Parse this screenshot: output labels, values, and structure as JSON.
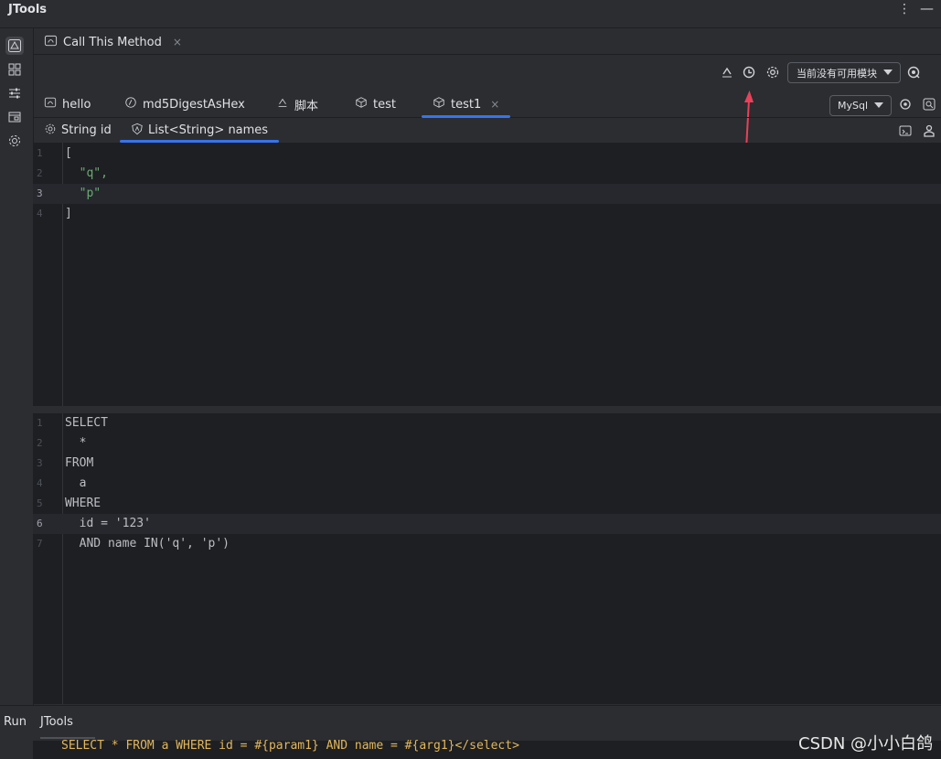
{
  "app": {
    "title": "JTools"
  },
  "outer_tab": {
    "label": "Call This Method",
    "close": "×"
  },
  "toolbar": {
    "module_select": "当前没有可用模块"
  },
  "method_tabs": [
    {
      "label": "hello"
    },
    {
      "label": "md5DigestAsHex"
    },
    {
      "label": "脚本"
    },
    {
      "label": "test"
    },
    {
      "label": "test1",
      "close": "×"
    }
  ],
  "db_select": "MySql",
  "param_tabs": [
    {
      "label": "String id"
    },
    {
      "label": "List<String> names"
    }
  ],
  "param_editor": {
    "lines": [
      {
        "n": "1",
        "text": "["
      },
      {
        "n": "2",
        "text": "  \"q\","
      },
      {
        "n": "3",
        "text": "  \"p\""
      },
      {
        "n": "4",
        "text": "]"
      }
    ]
  },
  "sql_editor": {
    "lines": [
      {
        "n": "1",
        "text": "SELECT"
      },
      {
        "n": "2",
        "text": "  *"
      },
      {
        "n": "3",
        "text": "FROM"
      },
      {
        "n": "4",
        "text": "  a"
      },
      {
        "n": "5",
        "text": "WHERE"
      },
      {
        "n": "6",
        "text": "  id = '123'"
      },
      {
        "n": "7",
        "text": "  AND name IN('q', 'p')"
      }
    ]
  },
  "bottom": {
    "run_label": "Run",
    "jtools_tab": "JTools",
    "console_text": "SELECT * FROM a WHERE id = #{param1} AND name = #{arg1}</select>"
  },
  "watermark": "CSDN @小小白鸽",
  "colors": {
    "accent": "#3574f0",
    "string": "#6aab73",
    "annotation": "#e8425a"
  }
}
